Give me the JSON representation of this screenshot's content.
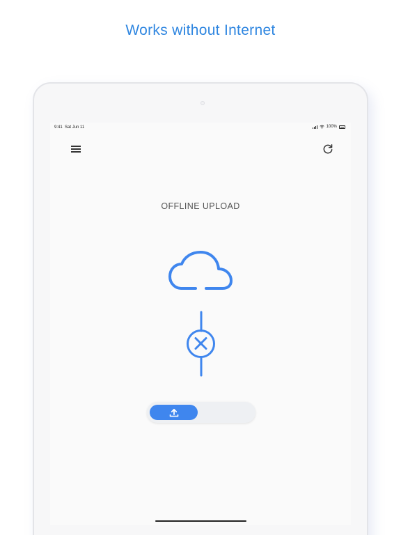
{
  "headline": "Works without Internet",
  "status": {
    "time": "9:41",
    "date": "Sat Jun 11",
    "battery": "100%"
  },
  "app": {
    "title": "OFFLINE UPLOAD",
    "upload_progress": 0.45
  },
  "colors": {
    "accent": "#3f86ee",
    "headline": "#2f86e0"
  },
  "icons": [
    "menu-icon",
    "refresh-icon",
    "cloud-icon",
    "connection-x-icon",
    "upload-icon"
  ]
}
